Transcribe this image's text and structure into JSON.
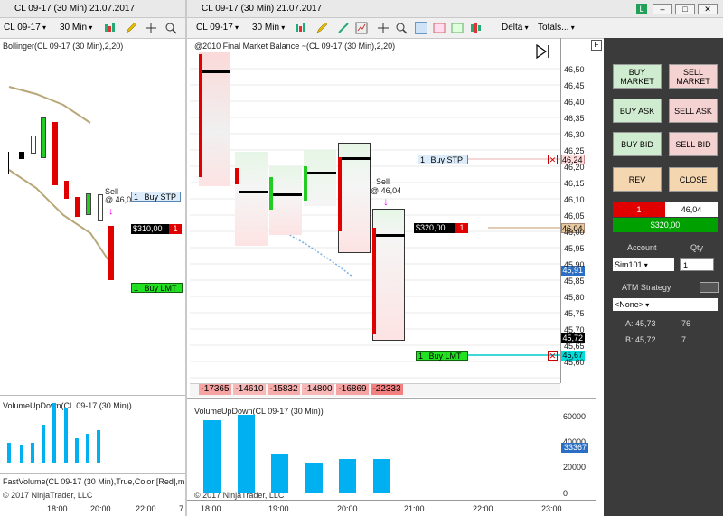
{
  "left_chart": {
    "title": "CL 09-17 (30 Min)  21.07.2017",
    "instrument": "CL 09-17",
    "interval": "30 Min",
    "indicator_label": "Bollinger(CL 09-17 (30 Min),2,20)",
    "sell_label": "Sell",
    "sell_price": "@ 46,04",
    "buy_stp_qty": "1",
    "buy_stp_label": "Buy STP",
    "position_pnl": "$310,00",
    "position_qty": "1",
    "buy_lmt_qty": "1",
    "buy_lmt_label": "Buy LMT",
    "volume_label": "VolumeUpDown(CL 09-17 (30 Min))",
    "fastvolume_label": "FastVolume(CL 09-17 (30 Min),True,Color [Red],ma",
    "copyright": "© 2017 NinjaTrader, LLC",
    "time_labels": [
      "18:00",
      "20:00",
      "22:00",
      "7"
    ],
    "colors": {
      "down": "#e00000",
      "up": "#22cc22",
      "volume": "#00b0f0",
      "bollinger": "#b8a878"
    }
  },
  "main_chart": {
    "title": "CL 09-17 (30 Min)  21.07.2017",
    "instrument": "CL 09-17",
    "interval": "30 Min",
    "delta_label": "Delta",
    "totals_label": "Totals...",
    "footprint_label": "@2010 Final Market Balance ~(CL 09-17 (30 Min),2,20)",
    "sell_label": "Sell",
    "sell_price": "@ 46,04",
    "buy_stp_qty": "1",
    "buy_stp_label": "Buy STP",
    "buy_stp_price": "46,24",
    "position_pnl": "$320,00",
    "position_qty": "1",
    "position_price": "46,04",
    "buy_lmt_qty": "1",
    "buy_lmt_label": "Buy LMT",
    "buy_lmt_price": "45,67",
    "last_price": "45,72",
    "marker_price": "45,91",
    "price_axis": [
      "46,50",
      "46,45",
      "46,40",
      "46,35",
      "46,30",
      "46,25",
      "46,20",
      "46,15",
      "46,10",
      "46,05",
      "46,00",
      "45,95",
      "45,90",
      "45,85",
      "45,80",
      "45,75",
      "45,70",
      "45,65",
      "45,60"
    ],
    "deltas": [
      "-17365",
      "-14610",
      "-15832",
      "-14800",
      "-16869",
      "-22333"
    ],
    "volume_label": "VolumeUpDown(CL 09-17 (30 Min))",
    "volume_axis": [
      "60000",
      "40000",
      "20000",
      "0"
    ],
    "volume_marker": "33367",
    "volume_fractions": [
      0.88,
      0.95,
      0.48,
      0.37,
      0.41,
      0.41
    ],
    "time_labels": [
      "18:00",
      "19:00",
      "20:00",
      "21:00",
      "22:00",
      "23:00"
    ],
    "copyright": "© 2017 NinjaTrader, LLC",
    "f_button": "F"
  },
  "order_panel": {
    "buy_market": "BUY MARKET",
    "sell_market": "SELL MARKET",
    "buy_ask": "BUY ASK",
    "sell_ask": "SELL ASK",
    "buy_bid": "BUY BID",
    "sell_bid": "SELL BID",
    "rev": "REV",
    "close": "CLOSE",
    "position_qty": "1",
    "position_price": "46,04",
    "position_pnl": "$320,00",
    "account_label": "Account",
    "qty_label": "Qty",
    "account_value": "Sim101",
    "qty_value": "1",
    "atm_label": "ATM Strategy",
    "atm_value": "<None>",
    "ask_label": "A: 45,73",
    "ask_size": "76",
    "bid_label": "B: 45,72",
    "bid_size": "7"
  },
  "window_controls": {
    "l_badge": "L"
  }
}
